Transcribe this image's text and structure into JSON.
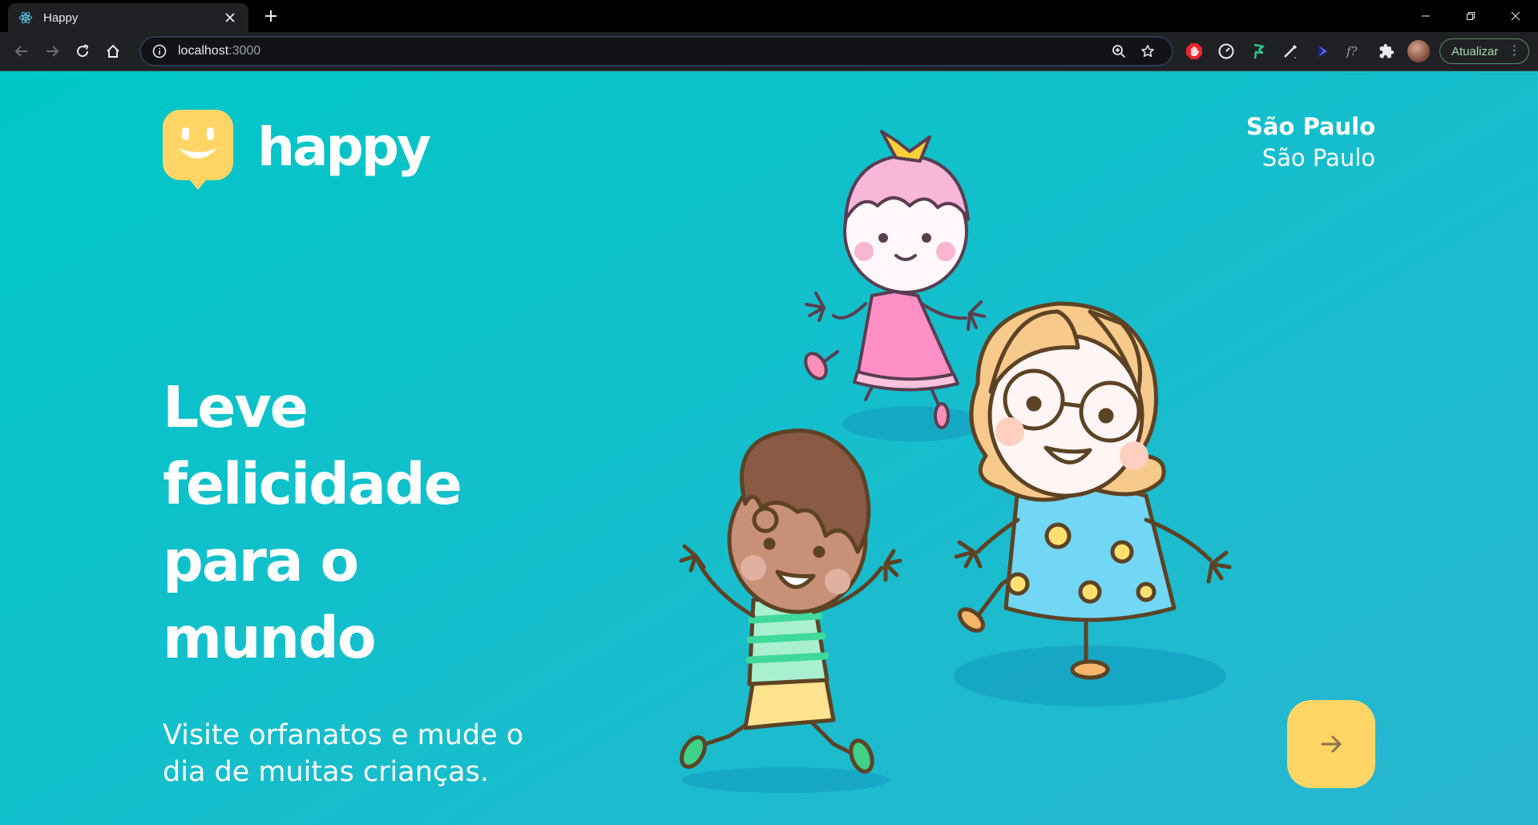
{
  "browser": {
    "tab": {
      "title": "Happy",
      "favicon": "react-icon",
      "close_icon": "close-icon"
    },
    "new_tab_icon": "plus-icon",
    "window_controls": [
      "minimize-icon",
      "restore-icon",
      "close-icon"
    ],
    "toolbar": {
      "url_host": "localhost",
      "url_port": ":3000",
      "update_label": "Atualizar"
    }
  },
  "page": {
    "logo": {
      "text": "happy",
      "icon": "happy-face-icon",
      "color": "#FFD666"
    },
    "location": {
      "city": "São Paulo",
      "state": "São Paulo"
    },
    "headline": "Leve felicidade para o mundo",
    "subtitle": "Visite orfanatos e mude o dia de muitas crianças.",
    "enter_button": {
      "icon": "arrow-right-icon",
      "color": "#FFD666"
    },
    "colors": {
      "gradient_start": "#00C7C7",
      "gradient_end": "#29B6D1",
      "arrow": "#8D734B"
    }
  }
}
